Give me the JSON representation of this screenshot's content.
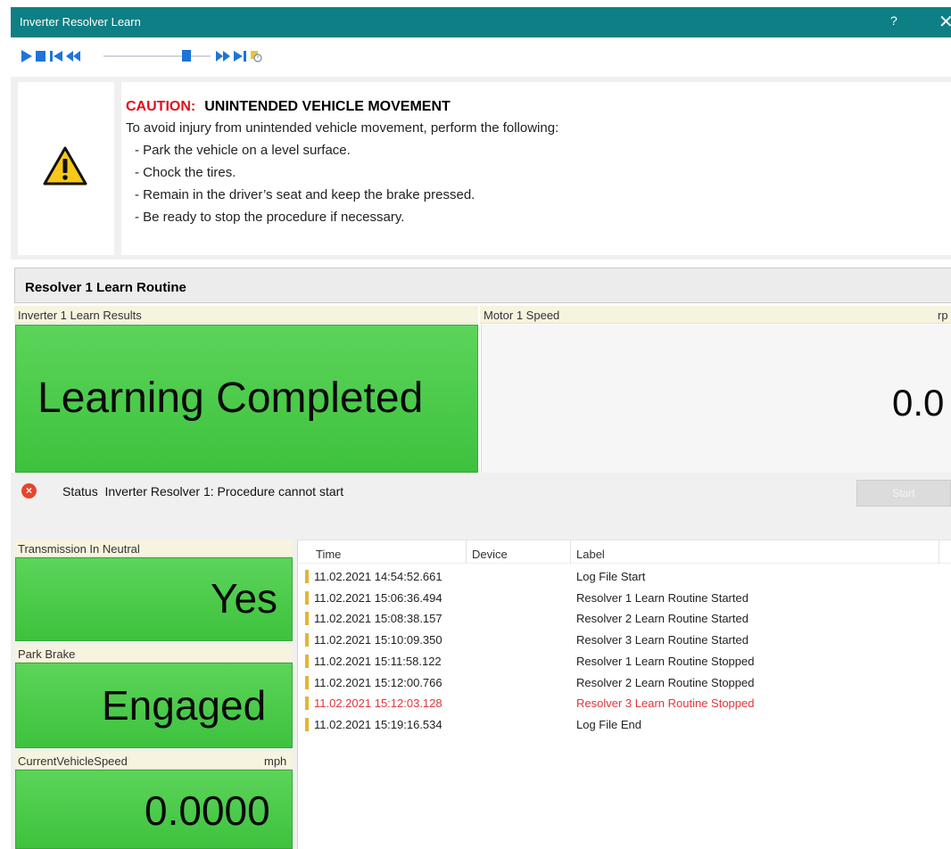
{
  "window": {
    "title": "Inverter Resolver Learn",
    "help_label": "?",
    "close_label": "✕"
  },
  "toolbar": {
    "buttons": [
      "play-icon",
      "stop-icon",
      "skip-back-icon",
      "rewind-icon",
      "fast-forward-icon",
      "skip-forward-icon",
      "settings-clock-icon"
    ],
    "slider_position": 0.75
  },
  "caution": {
    "prefix": "CAUTION:",
    "heading": "UNINTENDED VEHICLE MOVEMENT",
    "intro": "To avoid injury from unintended vehicle movement, perform the following:",
    "items": [
      "Park the vehicle on a level surface.",
      "Chock the tires.",
      "Remain in the driver’s seat and keep the brake pressed.",
      "Be ready to stop the procedure if necessary."
    ]
  },
  "routine": {
    "title": "Resolver 1 Learn Routine"
  },
  "inverter_results": {
    "label": "Inverter 1 Learn Results",
    "value": "Learning Completed"
  },
  "motor_speed": {
    "label": "Motor 1 Speed",
    "unit": "rp",
    "value": "0.0"
  },
  "status": {
    "label": "Status",
    "message": "Inverter Resolver 1: Procedure cannot start",
    "start_label": "Start"
  },
  "transmission": {
    "label": "Transmission In Neutral",
    "value": "Yes"
  },
  "park_brake": {
    "label": "Park Brake",
    "value": "Engaged"
  },
  "vehicle_speed": {
    "label": "CurrentVehicleSpeed",
    "unit": "mph",
    "value": "0.0000"
  },
  "log": {
    "columns": [
      "Time",
      "Device",
      "Label"
    ],
    "rows": [
      {
        "time": "11.02.2021 14:54:52.661",
        "device": "",
        "label": "Log File Start",
        "error": false
      },
      {
        "time": "11.02.2021 15:06:36.494",
        "device": "",
        "label": "Resolver 1 Learn Routine Started",
        "error": false
      },
      {
        "time": "11.02.2021 15:08:38.157",
        "device": "",
        "label": "Resolver 2 Learn Routine Started",
        "error": false
      },
      {
        "time": "11.02.2021 15:10:09.350",
        "device": "",
        "label": "Resolver 3 Learn Routine Started",
        "error": false
      },
      {
        "time": "11.02.2021 15:11:58.122",
        "device": "",
        "label": "Resolver 1 Learn Routine Stopped",
        "error": false
      },
      {
        "time": "11.02.2021 15:12:00.766",
        "device": "",
        "label": "Resolver 2 Learn Routine Stopped",
        "error": false
      },
      {
        "time": "11.02.2021 15:12:03.128",
        "device": "",
        "label": "Resolver 3 Learn Routine Stopped",
        "error": true
      },
      {
        "time": "11.02.2021 15:19:16.534",
        "device": "",
        "label": "Log File End",
        "error": false
      }
    ]
  },
  "colors": {
    "title_bar": "#0e7f85",
    "ok_green": "#4cc94a",
    "caution_red": "#e0101a",
    "error_text": "#e0353a",
    "toolbar_blue": "#1e74d8"
  }
}
